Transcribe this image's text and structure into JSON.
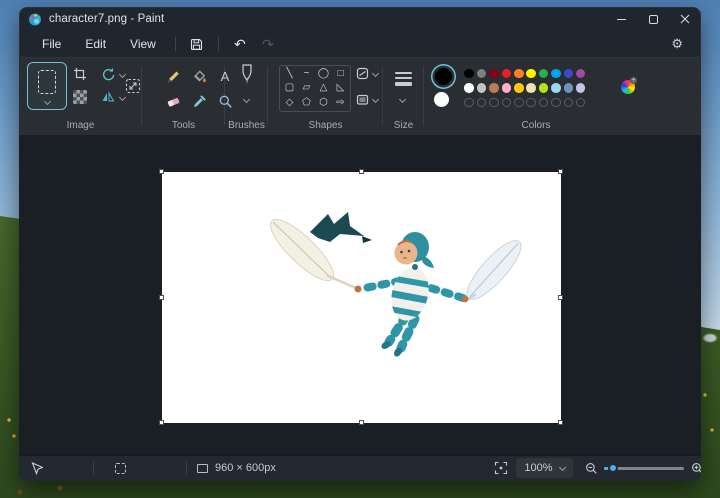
{
  "window": {
    "title": "character7.png - Paint"
  },
  "menu": {
    "items": [
      "File",
      "Edit",
      "View"
    ]
  },
  "icons": {
    "undo": "↶",
    "redo": "↷",
    "settings": "⚙",
    "text_tool": "A"
  },
  "ribbon": {
    "sections": {
      "image": "Image",
      "tools": "Tools",
      "brushes": "Brushes",
      "shapes": "Shapes",
      "size": "Size",
      "colors": "Colors"
    },
    "shapes": {
      "items": [
        {
          "name": "line",
          "glyph": "╲"
        },
        {
          "name": "curve",
          "glyph": "~"
        },
        {
          "name": "oval",
          "glyph": "◯"
        },
        {
          "name": "rectangle",
          "glyph": "□"
        },
        {
          "name": "rounded-rectangle",
          "glyph": "▢"
        },
        {
          "name": "polygon",
          "glyph": "▱"
        },
        {
          "name": "triangle",
          "glyph": "△"
        },
        {
          "name": "right-triangle",
          "glyph": "◺"
        },
        {
          "name": "diamond",
          "glyph": "◇"
        },
        {
          "name": "pentagon",
          "glyph": "⬠"
        },
        {
          "name": "hexagon",
          "glyph": "⬡"
        },
        {
          "name": "arrow",
          "glyph": "⇨"
        }
      ]
    },
    "colors": {
      "primary": "#000000",
      "secondary": "#ffffff",
      "accent": "#6cc5d9",
      "palette": [
        [
          "#000000",
          "#7f7f7f",
          "#880015",
          "#ed1c24",
          "#ff7f27",
          "#fff200",
          "#22b14c",
          "#00a2e8",
          "#3f48cc",
          "#a349a4"
        ],
        [
          "#ffffff",
          "#c3c3c3",
          "#b97a57",
          "#ffaec9",
          "#ffc90e",
          "#efe4b0",
          "#b5e61d",
          "#99d9ea",
          "#7092be",
          "#c8bfe7"
        ]
      ],
      "empty_slots": 10
    }
  },
  "statusbar": {
    "canvas_size": "960 × 600px",
    "zoom": "100%",
    "slider_color": "#4cb1e8"
  }
}
